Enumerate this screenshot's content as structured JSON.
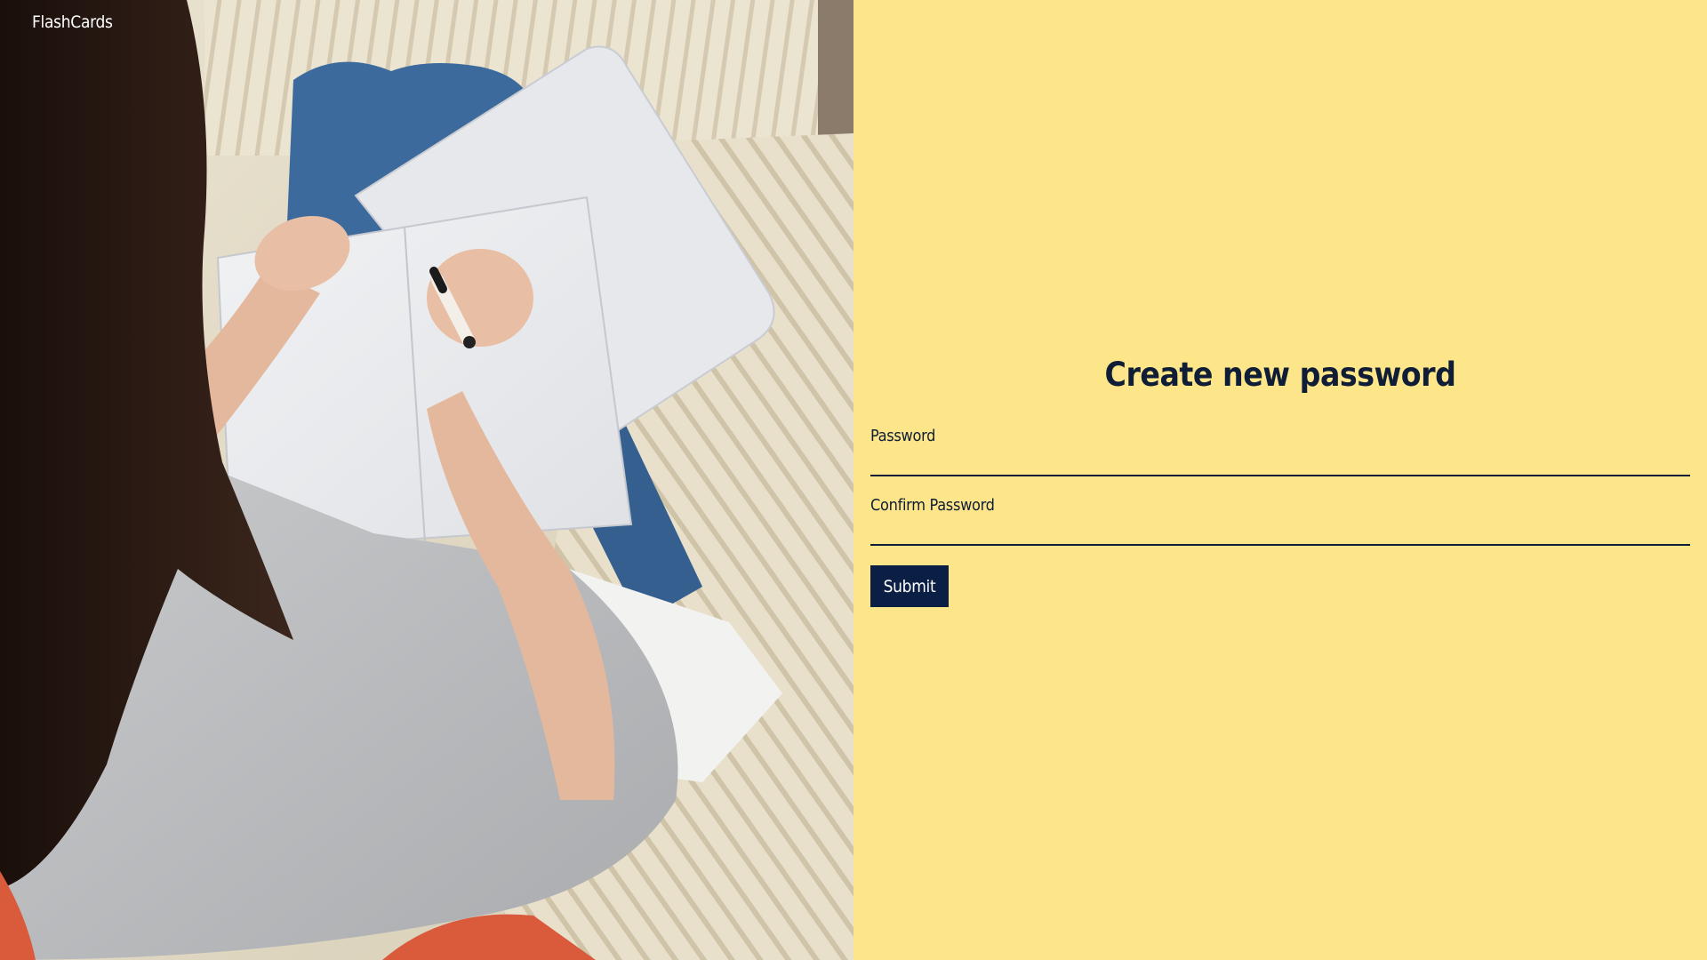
{
  "app": {
    "brand": "FlashCards"
  },
  "hero_image": {
    "icon": "woman-writing-in-notebook-photo"
  },
  "form": {
    "title": "Create new password",
    "fields": [
      {
        "label": "Password",
        "value": "",
        "placeholder": ""
      },
      {
        "label": "Confirm Password",
        "value": "",
        "placeholder": ""
      }
    ],
    "submit_label": "Submit"
  },
  "colors": {
    "form_background": "#fde68a",
    "primary_navy": "#0b1f44",
    "text_navy": "#0f1e36",
    "brand_text": "#ffffff"
  }
}
